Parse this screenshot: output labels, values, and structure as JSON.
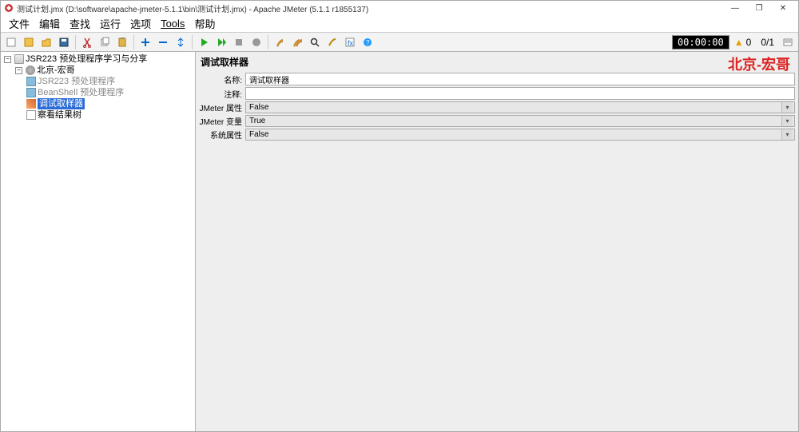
{
  "titlebar": {
    "icon": "jmeter-icon",
    "title": "测试计划.jmx (D:\\software\\apache-jmeter-5.1.1\\bin\\测试计划.jmx) - Apache JMeter (5.1.1 r1855137)"
  },
  "window_buttons": {
    "min": "—",
    "max": "❐",
    "close": "✕"
  },
  "menu": {
    "file": "文件",
    "edit": "编辑",
    "search": "查找",
    "run": "运行",
    "options": "选项",
    "tools": "Tools",
    "help": "帮助"
  },
  "toolbar": {
    "runtime": "00:00:00",
    "threads": "0/1",
    "warn_count": "0"
  },
  "tree": {
    "root": "JSR223  预处理程序学习与分享",
    "group": "北京-宏哥",
    "pre1": "JSR223 预处理程序",
    "pre2": "BeanShell 预处理程序",
    "sampler": "调试取样器",
    "tree_view": "察看结果树"
  },
  "panel": {
    "title": "调试取样器",
    "labels": {
      "name": "名称:",
      "comment": "注释:",
      "jp": "JMeter 属性",
      "jv": "JMeter 变量",
      "sp": "系统属性"
    },
    "values": {
      "name": "调试取样器",
      "comment": "",
      "jp": "False",
      "jv": "True",
      "sp": "False"
    }
  },
  "watermark": "北京-宏哥"
}
